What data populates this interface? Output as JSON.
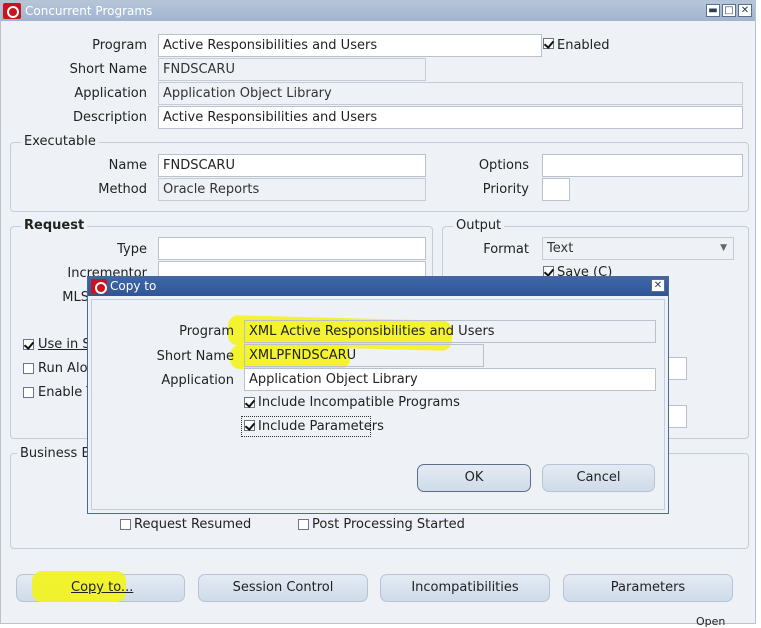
{
  "window": {
    "title": "Concurrent Programs",
    "min": "▬",
    "max": "□",
    "close": "✕"
  },
  "main": {
    "program_label": "Program",
    "program": "Active Responsibilities and Users",
    "enabled_label": "Enabled",
    "short_name_label": "Short Name",
    "short_name": "FNDSCARU",
    "application_label": "Application",
    "application": "Application Object Library",
    "description_label": "Description",
    "description": "Active Responsibilities and Users"
  },
  "executable": {
    "title": "Executable",
    "name_label": "Name",
    "name": "FNDSCARU",
    "method_label": "Method",
    "method": "Oracle Reports",
    "options_label": "Options",
    "options": "",
    "priority_label": "Priority",
    "priority": ""
  },
  "request": {
    "title": "Request",
    "type_label": "Type",
    "type": "",
    "incrementor_label": "Incrementor",
    "mls_label": "MLS",
    "use_in_label": "Use in S",
    "run_alone_label": "Run Alon",
    "enable_label": "Enable T"
  },
  "output": {
    "title": "Output",
    "format_label": "Format",
    "format": "Text",
    "save_label": "Save (C)"
  },
  "business": {
    "title": "Business Ev",
    "request_resumed": "Request Resumed",
    "post_processing": "Post Processing Started"
  },
  "buttons": {
    "copy_to": "Copy to...",
    "session_control": "Session Control",
    "incompatibilities": "Incompatibilities",
    "parameters": "Parameters"
  },
  "dialog": {
    "title": "Copy to",
    "close": "✕",
    "program_label": "Program",
    "program": "XML Active Responsibilities and Users",
    "short_name_label": "Short Name",
    "short_name": "XMLPFNDSCARU",
    "application_label": "Application",
    "application": "Application Object Library",
    "include_incompatible": "Include Incompatible Programs",
    "include_parameters": "Include Parameters",
    "ok": "OK",
    "cancel": "Cancel"
  },
  "footer_fragment": "Open",
  "colors": {
    "highlight": "#f3f31e",
    "dialog_title": "#2f5597",
    "window_title": "#a9bcd6",
    "oracle_red": "#c8141e"
  }
}
